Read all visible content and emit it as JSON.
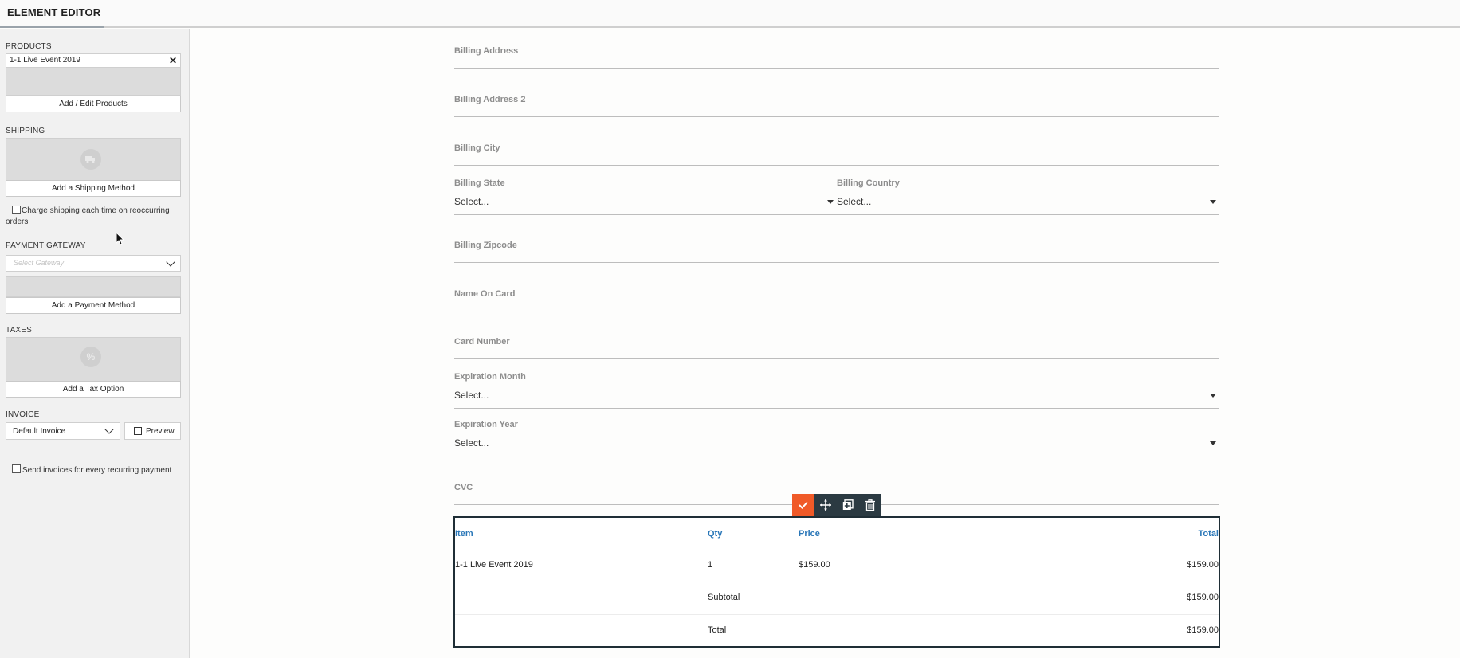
{
  "header": {
    "title": "ELEMENT EDITOR"
  },
  "sidebar": {
    "products": {
      "label": "PRODUCTS",
      "item": "1-1 Live Event 2019",
      "remove_symbol": "✕",
      "button": "Add / Edit Products"
    },
    "shipping": {
      "label": "SHIPPING",
      "icon": "truck-icon",
      "button": "Add a Shipping Method",
      "checkbox_label": "Charge shipping each time on reoccurring orders",
      "checked": false
    },
    "payment": {
      "label": "PAYMENT GATEWAY",
      "select_placeholder": "Select Gateway",
      "button": "Add a Payment Method"
    },
    "taxes": {
      "label": "TAXES",
      "icon": "percent-icon",
      "icon_glyph": "%",
      "button": "Add a Tax Option"
    },
    "invoice": {
      "label": "INVOICE",
      "selected": "Default Invoice",
      "preview_button": "Preview",
      "checkbox_label": "Send invoices for every recurring payment",
      "checked": false
    }
  },
  "form": {
    "fields": [
      {
        "label": "Billing Address"
      },
      {
        "label": "Billing Address 2"
      },
      {
        "label": "Billing City"
      },
      {
        "label": "Billing Zipcode"
      },
      {
        "label": "Name On Card"
      },
      {
        "label": "Card Number"
      },
      {
        "label": "CVC"
      }
    ],
    "billing_state": {
      "label": "Billing State",
      "value": "Select..."
    },
    "billing_country": {
      "label": "Billing Country",
      "value": "Select..."
    },
    "exp_month": {
      "label": "Expiration Month",
      "value": "Select..."
    },
    "exp_year": {
      "label": "Expiration Year",
      "value": "Select..."
    }
  },
  "toolbar": {
    "icons": [
      "check-icon",
      "move-icon",
      "duplicate-icon",
      "trash-icon"
    ],
    "accent": "#f05a28",
    "dark": "#2b3a42"
  },
  "order_table": {
    "columns": [
      "Item",
      "Qty",
      "Price",
      "Total"
    ],
    "row": {
      "item": "1-1 Live Event 2019",
      "qty": "1",
      "price": "$159.00",
      "total": "$159.00"
    },
    "subtotal": {
      "label": "Subtotal",
      "value": "$159.00"
    },
    "total": {
      "label": "Total",
      "value": "$159.00"
    },
    "header_color": "#2a77b8"
  }
}
